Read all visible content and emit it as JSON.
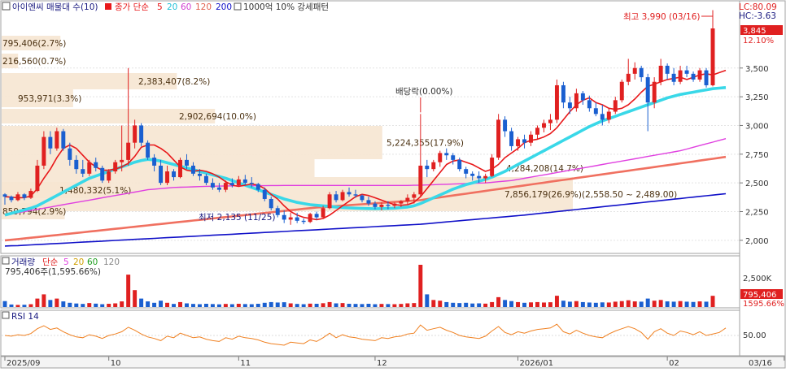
{
  "header": {
    "title": "아이엔씨 매물대 수(10)",
    "ma_label": "종가 단순",
    "ma_periods": [
      "5",
      "20",
      "60",
      "120",
      "200"
    ],
    "ma_colors": [
      "#e8181a",
      "#39d8e8",
      "#e040e0",
      "#f07060",
      "#1010c8"
    ],
    "pattern_label": "1000억 10% 강세패턴",
    "lc": "LC:80.09",
    "hc": "HC:-3.63"
  },
  "price_axis": {
    "ticks": [
      "3,500",
      "3,250",
      "3,000",
      "2,750",
      "2,500",
      "2,250",
      "2,000"
    ],
    "current_price": "3,845",
    "current_change": "12.10%"
  },
  "annotations": {
    "high": "최고 3,990 (03/16)",
    "low": "최저 2,135 (11/25)",
    "dividend": "배당락(0.00%)"
  },
  "volume_profile": [
    {
      "label": "795,406(2.7%)"
    },
    {
      "label": "216,560(0.7%)"
    },
    {
      "label": "2,383,407(8.2%)"
    },
    {
      "label": "953,971(3.3%)"
    },
    {
      "label": "2,902,694(10.0%)"
    },
    {
      "label": "5,224,355(17.9%)"
    },
    {
      "label": "4,284,208(14.7%)"
    },
    {
      "label": "7,856,179(26.9%)(2,558.50 ~ 2,489.00)"
    },
    {
      "label": "1,480,332(5.1%)"
    },
    {
      "label": "859,794(2.9%)"
    }
  ],
  "volume_panel": {
    "title": "거래량",
    "ma_label": "단순",
    "ma_periods": [
      "5",
      "20",
      "60",
      "120"
    ],
    "summary": "795,406주(1,595.66%)",
    "axis_tick": "2,500K",
    "current_volume": "795,406",
    "current_pct": "1595.66%"
  },
  "rsi_panel": {
    "title": "RSI 14",
    "axis_tick": "50.00"
  },
  "x_axis": {
    "labels": [
      "2025/09",
      "10",
      "11",
      "12",
      "2026/01",
      "02",
      "03"
    ],
    "cursor_date": "03/16"
  },
  "chart_data": {
    "type": "candlestick",
    "ylim": [
      1900,
      4050
    ],
    "yticks": [
      2000,
      2250,
      2500,
      2750,
      3000,
      3250,
      3500
    ],
    "month_index": [
      0,
      16,
      36,
      57,
      79,
      102,
      120
    ],
    "candles": [
      [
        2400,
        2410,
        2310,
        2380
      ],
      [
        2380,
        2390,
        2330,
        2350
      ],
      [
        2350,
        2420,
        2340,
        2400
      ],
      [
        2400,
        2410,
        2350,
        2370
      ],
      [
        2370,
        2450,
        2360,
        2430
      ],
      [
        2430,
        2700,
        2420,
        2650
      ],
      [
        2650,
        2950,
        2620,
        2900
      ],
      [
        2900,
        2950,
        2750,
        2800
      ],
      [
        2800,
        2980,
        2780,
        2950
      ],
      [
        2950,
        2970,
        2780,
        2800
      ],
      [
        2800,
        2850,
        2650,
        2700
      ],
      [
        2700,
        2740,
        2580,
        2620
      ],
      [
        2620,
        2700,
        2550,
        2580
      ],
      [
        2580,
        2700,
        2560,
        2680
      ],
      [
        2680,
        2720,
        2600,
        2630
      ],
      [
        2630,
        2650,
        2500,
        2520
      ],
      [
        2520,
        2620,
        2500,
        2600
      ],
      [
        2600,
        2700,
        2580,
        2680
      ],
      [
        2680,
        3000,
        2600,
        2700
      ],
      [
        2700,
        3500,
        2650,
        2850
      ],
      [
        2850,
        3050,
        2800,
        3000
      ],
      [
        3000,
        3020,
        2820,
        2850
      ],
      [
        2850,
        2870,
        2700,
        2720
      ],
      [
        2720,
        2750,
        2600,
        2650
      ],
      [
        2650,
        2700,
        2480,
        2500
      ],
      [
        2500,
        2650,
        2480,
        2600
      ],
      [
        2600,
        2620,
        2520,
        2550
      ],
      [
        2550,
        2720,
        2540,
        2700
      ],
      [
        2700,
        2750,
        2620,
        2650
      ],
      [
        2650,
        2680,
        2560,
        2580
      ],
      [
        2580,
        2620,
        2520,
        2560
      ],
      [
        2560,
        2580,
        2480,
        2500
      ],
      [
        2500,
        2540,
        2440,
        2460
      ],
      [
        2460,
        2500,
        2420,
        2440
      ],
      [
        2440,
        2520,
        2420,
        2500
      ],
      [
        2500,
        2540,
        2460,
        2480
      ],
      [
        2480,
        2560,
        2470,
        2530
      ],
      [
        2530,
        2570,
        2480,
        2500
      ],
      [
        2500,
        2550,
        2460,
        2490
      ],
      [
        2490,
        2500,
        2420,
        2440
      ],
      [
        2440,
        2460,
        2340,
        2360
      ],
      [
        2360,
        2380,
        2260,
        2280
      ],
      [
        2280,
        2300,
        2200,
        2220
      ],
      [
        2220,
        2260,
        2150,
        2180
      ],
      [
        2180,
        2240,
        2135,
        2200
      ],
      [
        2200,
        2240,
        2150,
        2170
      ],
      [
        2170,
        2190,
        2140,
        2160
      ],
      [
        2160,
        2240,
        2150,
        2230
      ],
      [
        2230,
        2250,
        2180,
        2200
      ],
      [
        2200,
        2300,
        2190,
        2280
      ],
      [
        2280,
        2420,
        2270,
        2400
      ],
      [
        2400,
        2430,
        2330,
        2350
      ],
      [
        2350,
        2440,
        2340,
        2420
      ],
      [
        2420,
        2460,
        2380,
        2400
      ],
      [
        2400,
        2440,
        2370,
        2390
      ],
      [
        2390,
        2400,
        2330,
        2350
      ],
      [
        2350,
        2380,
        2300,
        2320
      ],
      [
        2320,
        2340,
        2270,
        2290
      ],
      [
        2290,
        2330,
        2260,
        2310
      ],
      [
        2310,
        2340,
        2270,
        2300
      ],
      [
        2300,
        2330,
        2280,
        2320
      ],
      [
        2320,
        2350,
        2290,
        2340
      ],
      [
        2340,
        2400,
        2310,
        2370
      ],
      [
        2370,
        2420,
        2320,
        2400
      ],
      [
        2400,
        3100,
        2380,
        2650
      ],
      [
        2650,
        2700,
        2550,
        2620
      ],
      [
        2620,
        2700,
        2600,
        2680
      ],
      [
        2680,
        2780,
        2640,
        2760
      ],
      [
        2760,
        2800,
        2700,
        2740
      ],
      [
        2740,
        2760,
        2660,
        2700
      ],
      [
        2700,
        2720,
        2600,
        2620
      ],
      [
        2620,
        2640,
        2540,
        2580
      ],
      [
        2580,
        2600,
        2520,
        2560
      ],
      [
        2560,
        2600,
        2500,
        2540
      ],
      [
        2540,
        2580,
        2500,
        2560
      ],
      [
        2560,
        2750,
        2550,
        2720
      ],
      [
        2720,
        3100,
        2700,
        3050
      ],
      [
        3050,
        3080,
        2900,
        2950
      ],
      [
        2950,
        2980,
        2780,
        2820
      ],
      [
        2820,
        2900,
        2780,
        2880
      ],
      [
        2880,
        2920,
        2800,
        2850
      ],
      [
        2850,
        2950,
        2820,
        2920
      ],
      [
        2920,
        3000,
        2880,
        2980
      ],
      [
        2980,
        3050,
        2940,
        3020
      ],
      [
        3020,
        3100,
        2960,
        3050
      ],
      [
        3050,
        3400,
        3020,
        3350
      ],
      [
        3350,
        3380,
        3150,
        3200
      ],
      [
        3200,
        3250,
        3100,
        3150
      ],
      [
        3150,
        3320,
        3120,
        3280
      ],
      [
        3280,
        3300,
        3180,
        3220
      ],
      [
        3220,
        3260,
        3120,
        3150
      ],
      [
        3150,
        3200,
        3080,
        3100
      ],
      [
        3100,
        3180,
        3000,
        3050
      ],
      [
        3050,
        3150,
        3020,
        3120
      ],
      [
        3120,
        3250,
        3100,
        3220
      ],
      [
        3220,
        3400,
        3200,
        3380
      ],
      [
        3380,
        3580,
        3350,
        3450
      ],
      [
        3450,
        3550,
        3400,
        3500
      ],
      [
        3500,
        3520,
        3380,
        3420
      ],
      [
        3420,
        3450,
        2950,
        3200
      ],
      [
        3200,
        3420,
        3150,
        3380
      ],
      [
        3380,
        3580,
        3350,
        3520
      ],
      [
        3520,
        3540,
        3400,
        3450
      ],
      [
        3450,
        3500,
        3350,
        3380
      ],
      [
        3380,
        3520,
        3360,
        3480
      ],
      [
        3480,
        3520,
        3420,
        3450
      ],
      [
        3450,
        3470,
        3380,
        3400
      ],
      [
        3400,
        3500,
        3380,
        3480
      ],
      [
        3480,
        3500,
        3330,
        3350
      ],
      [
        3350,
        3990,
        3340,
        3845
      ]
    ],
    "ma5": [
      2380,
      2375,
      2370,
      2372,
      2385,
      2450,
      2540,
      2620,
      2720,
      2800,
      2830,
      2800,
      2740,
      2680,
      2640,
      2610,
      2610,
      2620,
      2640,
      2670,
      2730,
      2810,
      2830,
      2830,
      2800,
      2760,
      2700,
      2640,
      2610,
      2600,
      2610,
      2600,
      2580,
      2550,
      2510,
      2480,
      2470,
      2480,
      2490,
      2480,
      2450,
      2400,
      2360,
      2300,
      2250,
      2220,
      2200,
      2190,
      2180,
      2190,
      2220,
      2260,
      2300,
      2340,
      2380,
      2400,
      2390,
      2370,
      2350,
      2330,
      2310,
      2305,
      2310,
      2330,
      2380,
      2450,
      2520,
      2590,
      2660,
      2690,
      2700,
      2680,
      2660,
      2630,
      2600,
      2620,
      2660,
      2720,
      2760,
      2800,
      2850,
      2870,
      2880,
      2900,
      2930,
      2980,
      3050,
      3120,
      3180,
      3220,
      3240,
      3200,
      3180,
      3150,
      3140,
      3150,
      3180,
      3230,
      3290,
      3340,
      3360,
      3380,
      3400,
      3410,
      3420,
      3400,
      3420,
      3440,
      3450,
      3440,
      3460,
      3480
    ],
    "ma20": [
      2220,
      2235,
      2250,
      2265,
      2280,
      2300,
      2330,
      2360,
      2390,
      2420,
      2450,
      2480,
      2510,
      2540,
      2560,
      2580,
      2600,
      2620,
      2640,
      2660,
      2680,
      2695,
      2705,
      2700,
      2690,
      2675,
      2660,
      2645,
      2630,
      2615,
      2600,
      2585,
      2570,
      2555,
      2540,
      2520,
      2500,
      2480,
      2460,
      2440,
      2420,
      2400,
      2380,
      2360,
      2345,
      2330,
      2320,
      2310,
      2305,
      2300,
      2295,
      2290,
      2285,
      2282,
      2280,
      2278,
      2276,
      2275,
      2276,
      2278,
      2280,
      2285,
      2290,
      2300,
      2320,
      2345,
      2370,
      2395,
      2420,
      2445,
      2465,
      2485,
      2500,
      2515,
      2530,
      2550,
      2575,
      2600,
      2630,
      2660,
      2690,
      2720,
      2750,
      2780,
      2810,
      2840,
      2870,
      2900,
      2930,
      2960,
      2990,
      3015,
      3040,
      3060,
      3080,
      3100,
      3120,
      3140,
      3160,
      3180,
      3200,
      3220,
      3240,
      3255,
      3270,
      3280,
      3290,
      3300,
      3310,
      3320,
      3325,
      3330
    ],
    "ma60": [
      2220,
      2230,
      2240,
      2250,
      2260,
      2270,
      2280,
      2290,
      2300,
      2310,
      2320,
      2330,
      2340,
      2350,
      2360,
      2370,
      2380,
      2390,
      2400,
      2410,
      2420,
      2430,
      2440,
      2445,
      2450,
      2455,
      2460,
      2462,
      2464,
      2466,
      2468,
      2470,
      2471,
      2472,
      2473,
      2474,
      2475,
      2475,
      2475,
      2476,
      2476,
      2477,
      2477,
      2478,
      2478,
      2478,
      2478,
      2478,
      2478,
      2478,
      2478,
      2478,
      2478,
      2478,
      2478,
      2478,
      2478,
      2478,
      2478,
      2478,
      2478,
      2478,
      2478,
      2479,
      2480,
      2482,
      2484,
      2486,
      2488,
      2490,
      2492,
      2494,
      2496,
      2498,
      2500,
      2505,
      2510,
      2515,
      2520,
      2530,
      2540,
      2550,
      2560,
      2570,
      2580,
      2590,
      2600,
      2610,
      2620,
      2630,
      2640,
      2650,
      2660,
      2670,
      2680,
      2690,
      2700,
      2710,
      2720,
      2730,
      2740,
      2750,
      2760,
      2770,
      2780,
      2795,
      2810,
      2825,
      2840,
      2855,
      2870,
      2885
    ],
    "ma120": [
      2000,
      2005,
      2010,
      2016,
      2022,
      2028,
      2034,
      2040,
      2046,
      2052,
      2058,
      2064,
      2070,
      2076,
      2082,
      2088,
      2094,
      2100,
      2106,
      2112,
      2118,
      2124,
      2130,
      2136,
      2142,
      2148,
      2154,
      2160,
      2166,
      2172,
      2178,
      2184,
      2190,
      2196,
      2202,
      2208,
      2214,
      2220,
      2226,
      2232,
      2238,
      2244,
      2250,
      2256,
      2262,
      2268,
      2274,
      2280,
      2286,
      2290,
      2294,
      2298,
      2302,
      2306,
      2310,
      2314,
      2318,
      2322,
      2326,
      2330,
      2334,
      2338,
      2342,
      2346,
      2350,
      2358,
      2366,
      2374,
      2382,
      2390,
      2398,
      2406,
      2414,
      2422,
      2430,
      2438,
      2446,
      2454,
      2462,
      2470,
      2478,
      2486,
      2494,
      2502,
      2510,
      2518,
      2526,
      2534,
      2542,
      2550,
      2558,
      2566,
      2574,
      2582,
      2590,
      2598,
      2606,
      2614,
      2622,
      2630,
      2638,
      2646,
      2654,
      2662,
      2670,
      2678,
      2686,
      2694,
      2702,
      2710,
      2718,
      2726
    ],
    "ma200": [
      1950,
      1952,
      1954,
      1957,
      1960,
      1963,
      1966,
      1969,
      1972,
      1975,
      1978,
      1981,
      1984,
      1987,
      1990,
      1993,
      1996,
      1999,
      2002,
      2005,
      2008,
      2011,
      2014,
      2017,
      2020,
      2023,
      2026,
      2029,
      2032,
      2035,
      2038,
      2041,
      2044,
      2047,
      2050,
      2053,
      2056,
      2059,
      2062,
      2065,
      2068,
      2071,
      2074,
      2077,
      2080,
      2083,
      2086,
      2089,
      2092,
      2095,
      2098,
      2101,
      2104,
      2107,
      2110,
      2113,
      2116,
      2119,
      2122,
      2125,
      2128,
      2131,
      2134,
      2137,
      2140,
      2145,
      2150,
      2155,
      2160,
      2165,
      2170,
      2175,
      2180,
      2185,
      2190,
      2195,
      2200,
      2205,
      2210,
      2215,
      2220,
      2226,
      2232,
      2238,
      2244,
      2250,
      2256,
      2262,
      2268,
      2274,
      2280,
      2286,
      2292,
      2298,
      2304,
      2310,
      2316,
      2322,
      2328,
      2334,
      2340,
      2346,
      2352,
      2358,
      2364,
      2370,
      2376,
      2382,
      2388,
      2394,
      2400,
      2406
    ],
    "volume_max": 3000000,
    "volume": [
      420000,
      180000,
      150000,
      160000,
      200000,
      600000,
      900000,
      500000,
      600000,
      400000,
      300000,
      250000,
      220000,
      280000,
      240000,
      200000,
      230000,
      260000,
      400000,
      2300000,
      1200000,
      600000,
      400000,
      300000,
      450000,
      300000,
      220000,
      350000,
      260000,
      220000,
      200000,
      230000,
      210000,
      190000,
      220000,
      200000,
      230000,
      210000,
      200000,
      230000,
      300000,
      350000,
      320000,
      340000,
      260000,
      220000,
      200000,
      240000,
      230000,
      270000,
      350000,
      260000,
      280000,
      230000,
      220000,
      210000,
      230000,
      200000,
      220000,
      210000,
      200000,
      220000,
      260000,
      280000,
      3300000,
      900000,
      500000,
      450000,
      350000,
      300000,
      280000,
      300000,
      250000,
      260000,
      240000,
      350000,
      700000,
      500000,
      420000,
      350000,
      300000,
      330000,
      350000,
      320000,
      340000,
      800000,
      450000,
      380000,
      420000,
      350000,
      320000,
      300000,
      330000,
      320000,
      380000,
      420000,
      480000,
      400000,
      380000,
      600000,
      450000,
      500000,
      400000,
      380000,
      420000,
      380000,
      360000,
      400000,
      380000,
      795406
    ],
    "rsi": [
      50,
      48,
      52,
      50,
      55,
      68,
      76,
      66,
      70,
      60,
      52,
      46,
      44,
      52,
      48,
      42,
      50,
      54,
      60,
      72,
      64,
      54,
      46,
      42,
      36,
      48,
      44,
      56,
      50,
      44,
      46,
      40,
      36,
      34,
      44,
      40,
      48,
      44,
      42,
      38,
      32,
      28,
      26,
      24,
      32,
      30,
      28,
      38,
      34,
      44,
      56,
      44,
      52,
      46,
      44,
      40,
      38,
      36,
      44,
      42,
      46,
      48,
      54,
      56,
      78,
      64,
      68,
      72,
      64,
      58,
      50,
      46,
      44,
      42,
      48,
      62,
      74,
      58,
      52,
      60,
      56,
      62,
      66,
      68,
      70,
      80,
      60,
      54,
      64,
      56,
      50,
      46,
      44,
      54,
      62,
      68,
      74,
      68,
      58,
      40,
      60,
      68,
      56,
      50,
      62,
      58,
      52,
      60,
      50,
      54,
      58,
      70
    ]
  }
}
